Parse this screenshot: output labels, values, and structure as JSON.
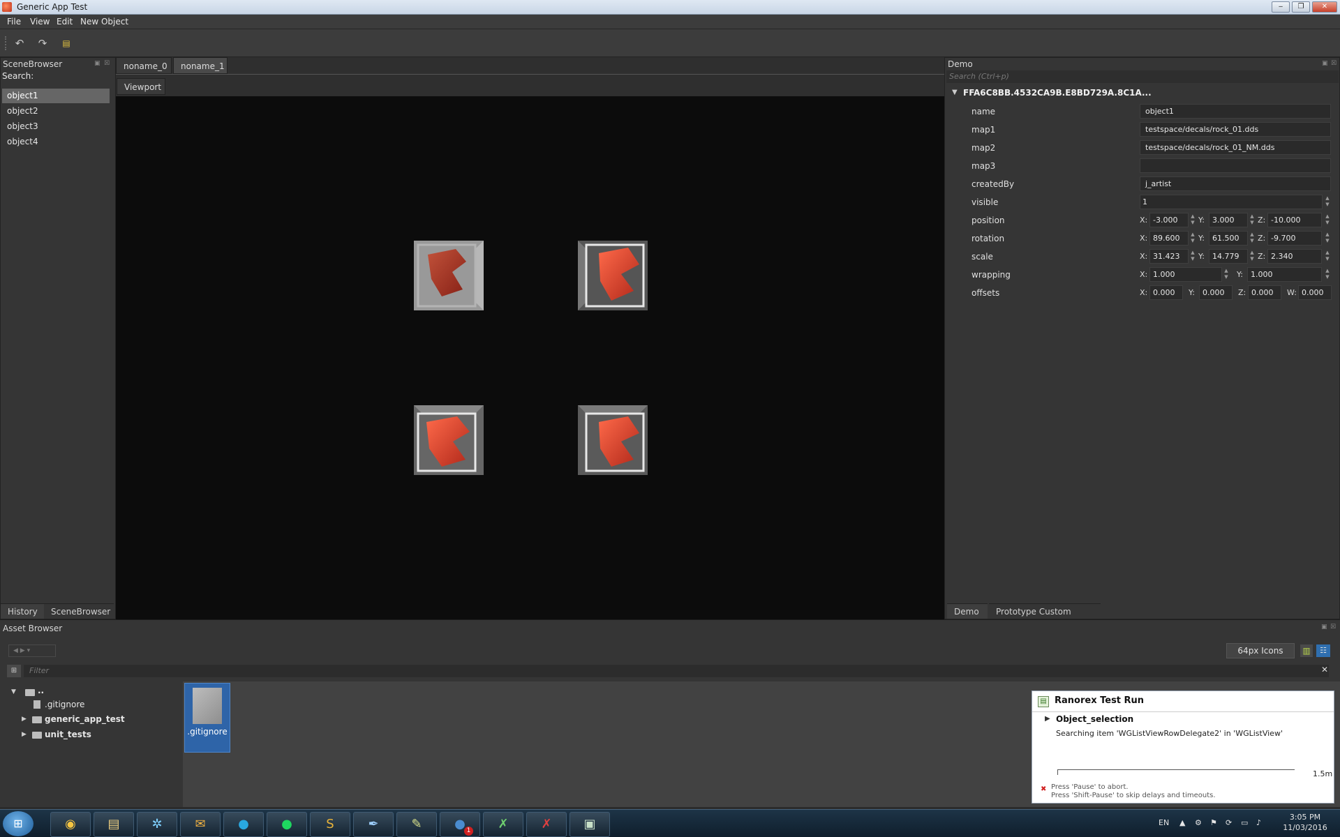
{
  "window": {
    "title": "Generic App Test"
  },
  "menu": [
    "File",
    "View",
    "Edit",
    "New Object"
  ],
  "scene_browser": {
    "title": "SceneBrowser",
    "search_label": "Search:",
    "items": [
      "object1",
      "object2",
      "object3",
      "object4"
    ],
    "bottom_tabs": [
      "History",
      "SceneBrowser"
    ]
  },
  "center": {
    "tabs": [
      "noname_0",
      "noname_1"
    ],
    "subtab": "Viewport"
  },
  "demo": {
    "title": "Demo",
    "search_placeholder": "Search (Ctrl+p)",
    "object_id": "FFA6C8BB.4532CA9B.E8BD729A.8C1A...",
    "props": {
      "name": {
        "label": "name",
        "value": "object1"
      },
      "map1": {
        "label": "map1",
        "value": "testspace/decals/rock_01.dds"
      },
      "map2": {
        "label": "map2",
        "value": "testspace/decals/rock_01_NM.dds"
      },
      "map3": {
        "label": "map3",
        "value": ""
      },
      "createdBy": {
        "label": "createdBy",
        "value": "j_artist"
      },
      "visible": {
        "label": "visible",
        "value": "1"
      },
      "position": {
        "label": "position",
        "x": "-3.000",
        "y": "3.000",
        "z": "-10.000"
      },
      "rotation": {
        "label": "rotation",
        "x": "89.600",
        "y": "61.500",
        "z": "-9.700"
      },
      "scale": {
        "label": "scale",
        "x": "31.423",
        "y": "14.779",
        "z": "2.340"
      },
      "wrapping": {
        "label": "wrapping",
        "x": "1.000",
        "y": "1.000"
      },
      "offsets": {
        "label": "offsets",
        "x": "0.000",
        "y": "0.000",
        "z": "0.000",
        "w": "0.000"
      }
    },
    "axis": {
      "x": "X:",
      "y": "Y:",
      "z": "Z:",
      "w": "W:"
    },
    "bottom_tabs": [
      "Demo",
      "Prototype Custom Panel"
    ]
  },
  "asset_browser": {
    "title": "Asset Browser",
    "icon_size": "64px Icons",
    "filter_placeholder": "Filter",
    "tree": [
      "..",
      ".gitignore",
      "generic_app_test",
      "unit_tests"
    ],
    "selected_file": ".gitignore"
  },
  "ranorex": {
    "title": "Ranorex Test Run",
    "step": "Object_selection",
    "message": "Searching item 'WGListViewRowDelegate2' in 'WGListView'",
    "timeout": "1.5m",
    "hint1": "Press 'Pause' to abort.",
    "hint2": "Press 'Shift-Pause' to skip delays and timeouts."
  },
  "taskbar": {
    "lang": "EN",
    "time": "3:05 PM",
    "date": "11/03/2016",
    "badge": "1"
  }
}
